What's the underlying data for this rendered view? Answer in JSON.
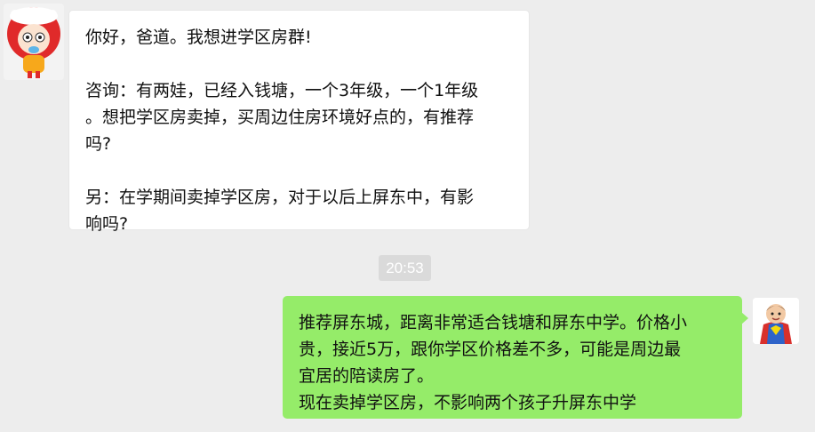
{
  "messages": [
    {
      "direction": "incoming",
      "avatar": "cartoon-girl-avatar",
      "text": "你好，爸道。我想进学区房群!\n\n咨询：有两娃，已经入钱塘，一个3年级，一个1年级\n。想把学区房卖掉，买周边住房环境好点的，有推荐\n吗?\n\n另：在学期间卖掉学区房，对于以后上屏东中，有影\n响吗?"
    },
    {
      "direction": "outgoing",
      "avatar": "superman-avatar",
      "text": "推荐屏东城，距离非常适合钱塘和屏东中学。价格小\n贵，接近5万，跟你学区价格差不多，可能是周边最\n宜居的陪读房了。\n现在卖掉学区房，不影响两个孩子升屏东中学"
    }
  ],
  "timestamp": "20:53",
  "colors": {
    "background": "#ededed",
    "incoming_bubble": "#ffffff",
    "outgoing_bubble": "#95ec69",
    "timestamp_bg": "#dadada"
  }
}
